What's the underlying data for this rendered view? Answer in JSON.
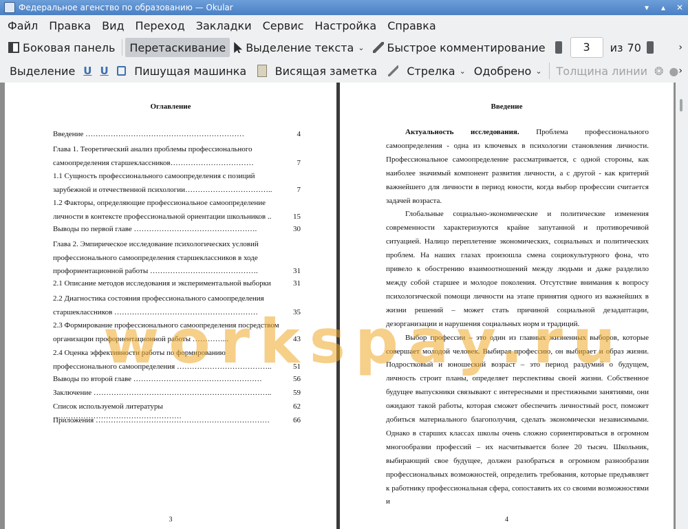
{
  "window": {
    "title": "Федеральное агенство по образованию  — Okular"
  },
  "menu": [
    "Файл",
    "Правка",
    "Вид",
    "Переход",
    "Закладки",
    "Сервис",
    "Настройка",
    "Справка"
  ],
  "toolbar1": {
    "sidebar": "Боковая панель",
    "drag": "Перетаскивание",
    "text_select": "Выделение текста",
    "quick_comment": "Быстрое комментирование",
    "page_current": "3",
    "page_of": "из",
    "page_total": "70"
  },
  "toolbar2": {
    "highlight": "Выделение",
    "typewriter": "Пишущая машинка",
    "sticky_note": "Висящая заметка",
    "arrow": "Стрелка",
    "approved": "Одобрено",
    "line_width": "Толщина линии"
  },
  "left_page": {
    "heading": "Оглавление",
    "toc": [
      {
        "text": "Введение ………………………………………………………",
        "page": "4"
      },
      {
        "text": "Глава 1. Теоретический анализ проблемы профессионального самоопределения старшеклассников……………………………",
        "page": "7"
      },
      {
        "text": "1.1 Сущность профессионального самоопределения с позиций зарубежной и отечественной психологии……………………………..",
        "page": "7"
      },
      {
        "text": "1.2 Факторы, определяющие профессиональное самоопределение личности в контексте профессиональной ориентации школьников ..",
        "page": "15"
      },
      {
        "text": "Выводы по первой  главе ………………………………………….",
        "page": "30"
      },
      {
        "text": "Глава 2. Эмпирическое исследование психологических условий профессионального самоопределения старшеклассников в ходе профориентационной работы …………………………………….",
        "page": "31"
      },
      {
        "text": "2.1 Описание методов исследования и экспериментальной выборки",
        "page": "31"
      },
      {
        "text": "2.2 Диагностика состояния профессионального самоопределения старшеклассников …………………………………………………",
        "page": "35"
      },
      {
        "text": "2.3 Формирование профессионального самоопределения посредством организации профориентационной работы …………...",
        "page": "43"
      },
      {
        "text": "2.4 Оценка эффективности работы по формированию профессионального самоопределения ………………………………..",
        "page": "51"
      },
      {
        "text": "Выводы по второй  главе ……………………………………………",
        "page": "56"
      },
      {
        "text": "Заключение ……………………………………………………………..",
        "page": "59"
      },
      {
        "text": "Список используемой литературы ……………………………………………",
        "page": "62"
      },
      {
        "text": "Приложения ……………………………………………………………",
        "page": "66"
      }
    ],
    "page_number": "3"
  },
  "right_page": {
    "heading": "Введение",
    "lead_bold": "Актуальность исследования.",
    "paragraphs": [
      " Проблема профессионального самоопределения - одна из ключевых в психологии становления личности. Профессиональное самоопределение рассматривается, с одной стороны, как наиболее значимый компонент развития личности, а с другой - как критерий важнейшего для личности в период юности, когда выбор профессии считается задачей возраста.",
      "Глобальные социально-экономические и политические изменения современности характеризуются крайне запутанной и противоречивой ситуацией. Налицо переплетение экономических, социальных и политических проблем. На наших глазах произошла смена социокультурного фона, что привело к обострению взаимоотношений между людьми и даже разделило между собой старшее и молодое поколения. Отсутствие внимания к вопросу психологической помощи личности на этапе принятия одного из важнейших в жизни решений – может стать причиной социальной дезадаптации,  дезорганизации и нарушения социальных норм и традиций.",
      "Выбор профессии – это один из главных жизненных выборов, которые совершает молодой человек. Выбирая профессию, он выбирает и образ жизни. Подростковый и юношеский возраст – это период раздумий о будущем, личность строит планы, определяет перспективы своей жизни. Собственное будущее выпускники связывают с интересными и престижными занятиями, они ожидают такой работы, которая сможет обеспечить личностный рост, поможет добиться материального благополучия, сделать экономически независимыми. Однако в старших классах школы очень сложно сориентироваться в огромном многообразии профессий – их насчитывается более 20 тысяч. Школьник, выбирающий свое будущее, должен разобраться в огромном разнообразии профессиональных возможностей, определить требования, которые предъявляет к работнику профессиональная сфера, сопоставить их со своими возможностями и"
    ],
    "page_number": "4"
  },
  "watermark": "workspay.ru",
  "colors": {
    "titlebar": "#4a7fc4",
    "watermark": "#eea828",
    "toolbar_bg": "#eff0f1"
  }
}
